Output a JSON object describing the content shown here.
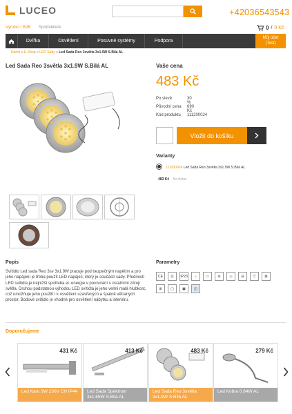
{
  "header": {
    "logo": "LUCEO",
    "search_placeholder": "",
    "phone": "+42036543543"
  },
  "subnav": {
    "b2b": "Výrobci / B2B",
    "consumption": "Spotřebitelé"
  },
  "cart": {
    "count": "0",
    "price": "0 Kč"
  },
  "nav": {
    "items": [
      "Dvířka",
      "Osvětlení",
      "Posuvné systémy",
      "Podpora"
    ],
    "account_line1": "Můj účet",
    "account_line2": "(Test)"
  },
  "breadcrumb": {
    "home": "Domů",
    "eshop": "E-Shop",
    "category": "LED Sady",
    "current": "Led Sada Reo 3světla 3x1.9W S.Bílá AL",
    "sep": "»"
  },
  "product": {
    "title": "Led Sada Reo 3světla 3x1.9W S.Bílá AL",
    "price_label": "Vaše cena",
    "price": "483 Kč",
    "specs": [
      {
        "label": "Po slevě",
        "value": "30 %"
      },
      {
        "label": "Původní cena",
        "value": "690 Kč"
      },
      {
        "label": "Kód produktu",
        "value": "111200024"
      }
    ],
    "buy_label": "Vložit do košíku",
    "variants_label": "Varianty",
    "variant_code": "111200024",
    "variant_name": "Led Sada Reo 3světla 3x1.9W S.Bílá AL",
    "variant_price": "483 Kč",
    "variant_stock": "Na dotaz"
  },
  "description": {
    "title": "Popis",
    "text": "Svítidlo Led sada Reo 3sv 3x1.9W pracuje pod bezpečným napětím a pro jeho napájení je třeba použít LED napáječ, který je součástí sady. Přednosti LED svítidla je nejnižší spotřeba el. energie v porovnání s ostatními zdroji světla. Druhou podstatnou výhodou LED svítidla je jeho velmi malá hlubkost, což umožňuje jeho použití i k osvětlení uzavřených a špatně větraných prostor. Bodové svítidlo je vhodné pro osvětlení nábytku a interiéru."
  },
  "parameters": {
    "title": "Parametry",
    "icons_row1": [
      "CE",
      "⊡",
      "IP20",
      "⌂",
      "▭",
      "⊘",
      "◇",
      "⊟",
      "▽",
      "⊠"
    ],
    "icons_row2": [
      "⊞",
      "▢",
      "▣",
      "◫"
    ]
  },
  "recommended": {
    "title": "Doporučujeme",
    "cards": [
      {
        "price": "431 Kč",
        "name": "Led Karo 3W 230V CH IP44",
        "style": "orange"
      },
      {
        "price": "413 Kč",
        "name": "Led Sada Spektrum 3x1.65W S.Bílá AL",
        "style": "gray"
      },
      {
        "price": "483 Kč",
        "name": "Led Sada Reo 3světla 3x1.9W S.Bílá AL",
        "style": "orange"
      },
      {
        "price": "279 Kč",
        "name": "Led Kobra 0.84W AL",
        "style": "gray"
      }
    ]
  },
  "colors": {
    "accent": "#f39200",
    "nav": "#3a3a3a"
  }
}
